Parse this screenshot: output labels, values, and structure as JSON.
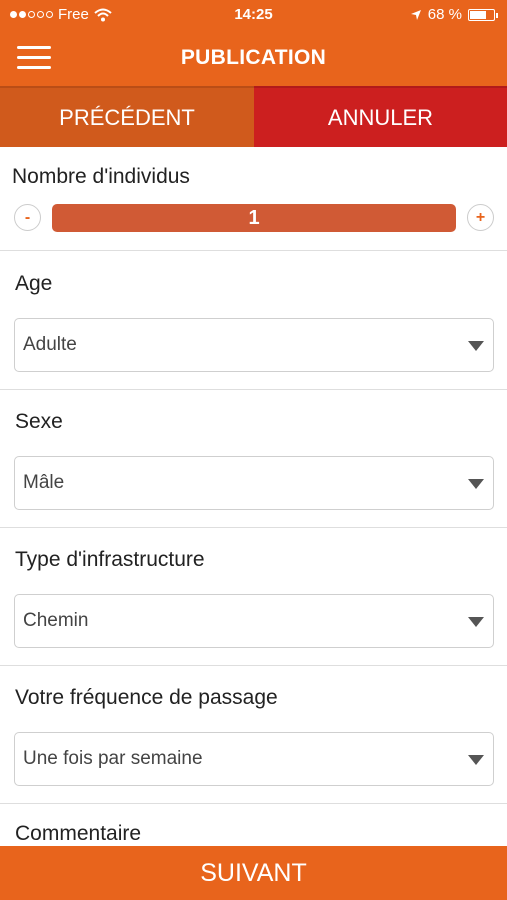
{
  "status_bar": {
    "carrier": "Free",
    "time": "14:25",
    "battery_percent": "68 %",
    "battery_level": 0.68,
    "signal_bars": 2
  },
  "header": {
    "title": "PUBLICATION"
  },
  "actions": {
    "previous_label": "PRÉCÉDENT",
    "cancel_label": "ANNULER"
  },
  "form": {
    "individuals": {
      "label": "Nombre d'individus",
      "value": "1",
      "minus": "-",
      "plus": "+"
    },
    "age": {
      "label": "Age",
      "selected": "Adulte"
    },
    "sex": {
      "label": "Sexe",
      "selected": "Mâle"
    },
    "infrastructure": {
      "label": "Type d'infrastructure",
      "selected": "Chemin"
    },
    "frequency": {
      "label": "Votre fréquence de passage",
      "selected": "Une fois par semaine"
    },
    "comment": {
      "label": "Commentaire"
    }
  },
  "footer": {
    "next_label": "SUIVANT"
  },
  "colors": {
    "brand_orange": "#e8641c",
    "cancel_red": "#cc1f1f",
    "stepper_bar": "#d05a35"
  }
}
